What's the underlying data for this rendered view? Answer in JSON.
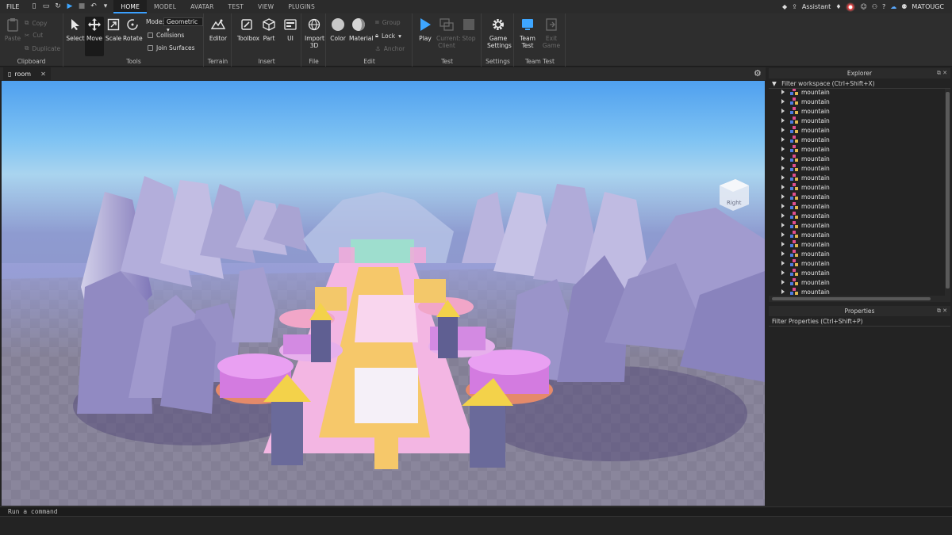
{
  "menubar": {
    "file_label": "FILE",
    "tabs": [
      "HOME",
      "MODEL",
      "AVATAR",
      "TEST",
      "VIEW",
      "PLUGINS"
    ],
    "active_tab": "HOME",
    "assistant_label": "Assistant",
    "username": "MATOUGC"
  },
  "ribbon": {
    "clipboard": {
      "label": "Clipboard",
      "paste": "Paste",
      "copy": "Copy",
      "cut": "Cut",
      "duplicate": "Duplicate"
    },
    "tools": {
      "label": "Tools",
      "select": "Select",
      "move": "Move",
      "scale": "Scale",
      "rotate": "Rotate",
      "mode_label": "Mode:",
      "mode_value": "Geometric",
      "collisions": "Collisions",
      "join_surfaces": "Join Surfaces"
    },
    "terrain": {
      "label": "Terrain",
      "editor": "Editor"
    },
    "insert": {
      "label": "Insert",
      "toolbox": "Toolbox",
      "part": "Part",
      "ui": "UI"
    },
    "file": {
      "label": "File",
      "import3d": "Import 3D"
    },
    "edit": {
      "label": "Edit",
      "color": "Color",
      "material": "Material",
      "group": "Group",
      "lock": "Lock",
      "anchor": "Anchor"
    },
    "test": {
      "label": "Test",
      "play": "Play",
      "current_client": "Current: Client",
      "stop": "Stop"
    },
    "settings": {
      "label": "Settings",
      "game_settings": "Game Settings"
    },
    "team_test": {
      "label": "Team Test",
      "team_test": "Team Test",
      "exit_game": "Exit Game"
    }
  },
  "viewport": {
    "tab_title": "room",
    "view_cube_label": "Right"
  },
  "explorer": {
    "title": "Explorer",
    "filter_placeholder": "Filter workspace (Ctrl+Shift+X)",
    "items": [
      "mountain",
      "mountain",
      "mountain",
      "mountain",
      "mountain",
      "mountain",
      "mountain",
      "mountain",
      "mountain",
      "mountain",
      "mountain",
      "mountain",
      "mountain",
      "mountain",
      "mountain",
      "mountain",
      "mountain",
      "mountain",
      "mountain",
      "mountain",
      "mountain",
      "mountain"
    ]
  },
  "properties": {
    "title": "Properties",
    "filter_placeholder": "Filter Properties (Ctrl+Shift+P)"
  },
  "command_bar": {
    "placeholder": "Run a command"
  },
  "colors": {
    "accent": "#3aa0ff",
    "panel_bg": "#2e2e2e",
    "dark_bg": "#232323",
    "play_blue": "#3ea6ff"
  }
}
